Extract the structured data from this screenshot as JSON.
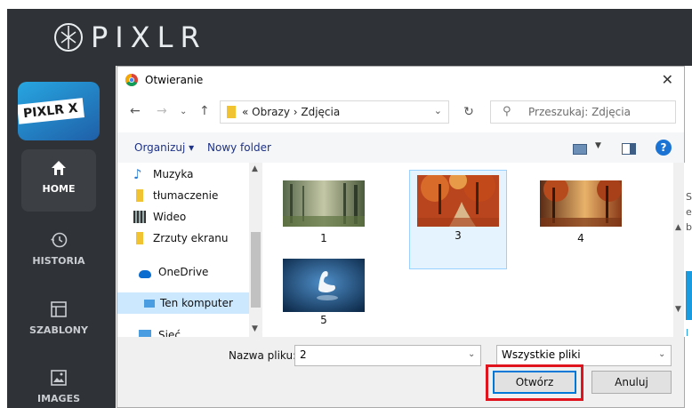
{
  "app": {
    "brand": "PIXLR",
    "badge": "PIXLR X",
    "nav": [
      {
        "label": "HOME",
        "icon": "home-icon"
      },
      {
        "label": "HISTORIA",
        "icon": "history-icon"
      },
      {
        "label": "SZABLONY",
        "icon": "template-icon"
      },
      {
        "label": "IMAGES",
        "icon": "image-icon"
      }
    ],
    "peek_letters": [
      "S",
      "e",
      "b",
      "l"
    ]
  },
  "dialog": {
    "title": "Otwieranie",
    "close": "✕",
    "address": {
      "prefix": "«",
      "crumbs": "Obrazy  ›  Zdjęcia"
    },
    "search_placeholder": "Przeszukaj: Zdjęcia",
    "toolbar": {
      "organize": "Organizuj ▾",
      "new_folder": "Nowy folder"
    },
    "nav_items": [
      {
        "label": "Muzyka",
        "icon": "music-icon"
      },
      {
        "label": "tłumaczenie",
        "icon": "folder-icon"
      },
      {
        "label": "Wideo",
        "icon": "video-icon"
      },
      {
        "label": "Zrzuty ekranu",
        "icon": "folder-icon"
      },
      {
        "label": "OneDrive",
        "icon": "cloud-icon"
      },
      {
        "label": "Ten komputer",
        "icon": "computer-icon"
      },
      {
        "label": "Sieć",
        "icon": "network-icon"
      }
    ],
    "files": [
      {
        "name": "1",
        "scene": "misty-forest"
      },
      {
        "name": "3",
        "scene": "autumn-path",
        "selected": true
      },
      {
        "name": "4",
        "scene": "autumn-forest"
      },
      {
        "name": "5",
        "scene": "swan"
      }
    ],
    "filename_label": "Nazwa pliku:",
    "filename_value": "2",
    "filter_value": "Wszystkie pliki",
    "open_label": "Otwórz",
    "cancel_label": "Anuluj",
    "colors": {
      "highlight": "#e0141c",
      "selection": "#cce8ff",
      "primary_border": "#0078d7"
    }
  }
}
